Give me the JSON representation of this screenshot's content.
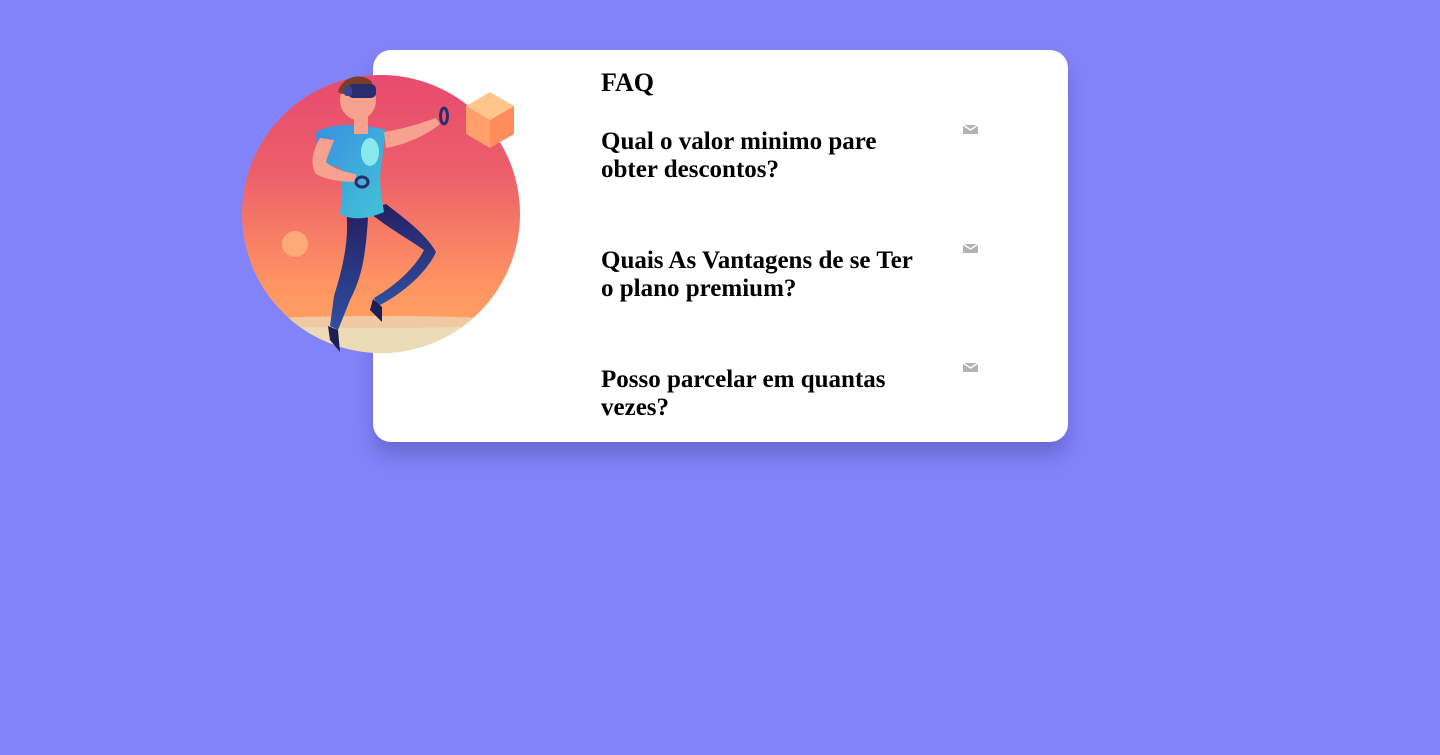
{
  "faq": {
    "title": "FAQ",
    "items": [
      {
        "question": "Qual o valor minimo pare obter descontos?",
        "icon": "expand-arrow-icon"
      },
      {
        "question": "Quais As Vantagens de se Ter o plano premium?",
        "icon": "expand-arrow-icon"
      },
      {
        "question": "Posso parcelar em quantas vezes?",
        "icon": "expand-arrow-icon"
      }
    ]
  },
  "illustration": {
    "subject": "vr-person-illustration",
    "colors": {
      "circle_top": "#e84a6e",
      "circle_bottom": "#ffa063",
      "ground": "#ecdbb6",
      "cube": "#ffab72",
      "shirt": "#3aa3dc",
      "pants": "#252e7a",
      "hair": "#7a3d2a",
      "skin": "#f7a18f"
    }
  },
  "colors": {
    "background": "#8383f9",
    "card": "#ffffff",
    "icon": "#b3b3b3"
  }
}
